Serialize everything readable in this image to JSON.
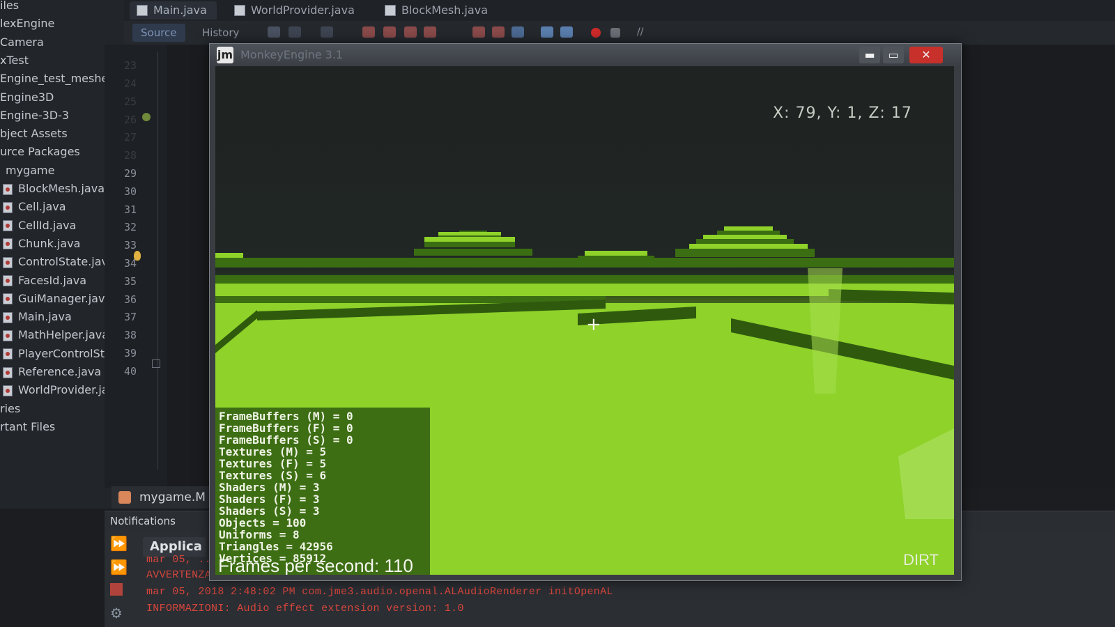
{
  "project_tree": {
    "items": [
      {
        "label": "iles",
        "indent": 0
      },
      {
        "label": "lexEngine",
        "indent": 0
      },
      {
        "label": "Camera",
        "indent": 0
      },
      {
        "label": "xTest",
        "indent": 0
      },
      {
        "label": "Engine_test_meshes",
        "indent": 0
      },
      {
        "label": "Engine3D",
        "indent": 0
      },
      {
        "label": "Engine-3D-3",
        "indent": 0
      },
      {
        "label": "bject Assets",
        "indent": 0
      },
      {
        "label": "urce Packages",
        "indent": 0
      },
      {
        "label": "mygame",
        "indent": 0
      },
      {
        "label": "BlockMesh.java",
        "indent": 1
      },
      {
        "label": "Cell.java",
        "indent": 1
      },
      {
        "label": "CellId.java",
        "indent": 1
      },
      {
        "label": "Chunk.java",
        "indent": 1
      },
      {
        "label": "ControlState.jav",
        "indent": 1
      },
      {
        "label": "FacesId.java",
        "indent": 1
      },
      {
        "label": "GuiManager.jav",
        "indent": 1
      },
      {
        "label": "Main.java",
        "indent": 1
      },
      {
        "label": "MathHelper.java",
        "indent": 1
      },
      {
        "label": "PlayerControlSt",
        "indent": 1
      },
      {
        "label": "Reference.java",
        "indent": 1
      },
      {
        "label": "WorldProvider.ja",
        "indent": 1
      },
      {
        "label": "ries",
        "indent": 0
      },
      {
        "label": "rtant Files",
        "indent": 0
      }
    ]
  },
  "editor_tabs": [
    {
      "label": "Main.java",
      "active": true
    },
    {
      "label": "WorldProvider.java",
      "active": false
    },
    {
      "label": "BlockMesh.java",
      "active": false
    }
  ],
  "editor_subtabs": [
    "Source",
    "History"
  ],
  "gutter": {
    "line_numbers": [
      "23",
      "24",
      "25",
      "26",
      "27",
      "28",
      "29",
      "30",
      "31",
      "32",
      "33",
      "34",
      "35",
      "36",
      "37",
      "38",
      "39",
      "40"
    ]
  },
  "navigator_tab": {
    "label": "mygame.M"
  },
  "notifications": {
    "label": "Notifications"
  },
  "output": {
    "tab_label": "Applica",
    "log_lines": [
      "mar 05, ...",
      "AVVERTENZA: Pausing audio device not supported.",
      "mar 05, 2018 2:48:02 PM com.jme3.audio.openal.ALAudioRenderer initOpenAL",
      "INFORMAZIONI: Audio effect extension version: 1.0"
    ]
  },
  "game_window": {
    "title": "MonkeyEngine 3.1",
    "logo_glyph": "jm",
    "minimize_glyph": "▬",
    "maximize_glyph": "▭",
    "close_glyph": "✕",
    "coords_text": "X: 79, Y: 1, Z: 17",
    "crosshair_glyph": "+",
    "stats": [
      "FrameBuffers (M) = 0",
      "FrameBuffers (F) = 0",
      "FrameBuffers (S) = 0",
      "Textures (M) = 5",
      "Textures (F) = 5",
      "Textures (S) = 6",
      "Shaders (M) = 3",
      "Shaders (F) = 3",
      "Shaders (S) = 3",
      "Objects = 100",
      "Uniforms = 8",
      "Triangles = 42956",
      "Vertices = 85912"
    ],
    "fps_text": "Frames per second: 110",
    "block_type": "DIRT"
  },
  "colors": {
    "grass_light": "#8ed22a",
    "grass_dark": "#3b6e12",
    "stats_bg": "#3d6e14",
    "close_button": "#c8302b",
    "log_red": "#d6463c"
  }
}
